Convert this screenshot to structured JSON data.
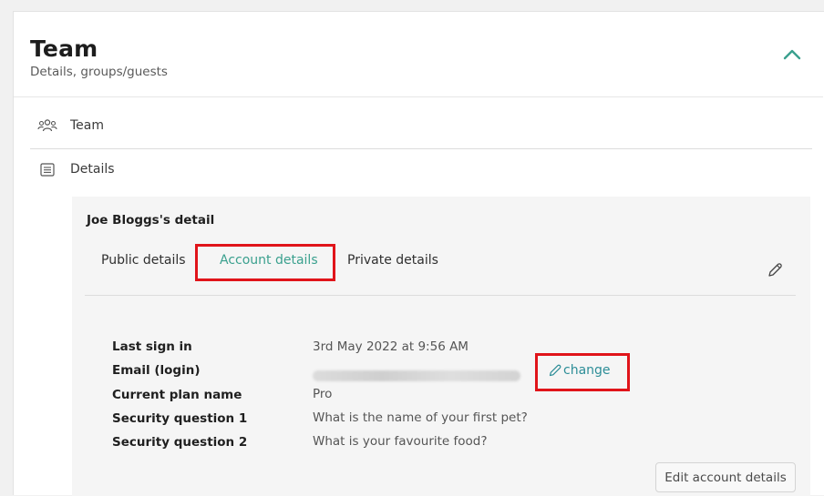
{
  "section": {
    "title": "Team",
    "subtitle": "Details, groups/guests"
  },
  "nav": {
    "team_label": "Team",
    "details_label": "Details"
  },
  "panel": {
    "title": "Joe Bloggs's detail",
    "tabs": [
      {
        "label": "Public details",
        "active": false
      },
      {
        "label": "Account details",
        "active": true
      },
      {
        "label": "Private details",
        "active": false
      }
    ],
    "fields": [
      {
        "label": "Last sign in",
        "value": "3rd May 2022 at 9:56 AM"
      },
      {
        "label": "Email (login)",
        "value": ""
      },
      {
        "label": "Current plan name",
        "value": "Pro"
      },
      {
        "label": "Security question 1",
        "value": "What is the name of your first pet?"
      },
      {
        "label": "Security question 2",
        "value": "What is your favourite food?"
      }
    ],
    "change_label": "change",
    "edit_button_label": "Edit account details"
  },
  "colors": {
    "accent": "#3aa08e",
    "highlight": "#e0141a"
  }
}
